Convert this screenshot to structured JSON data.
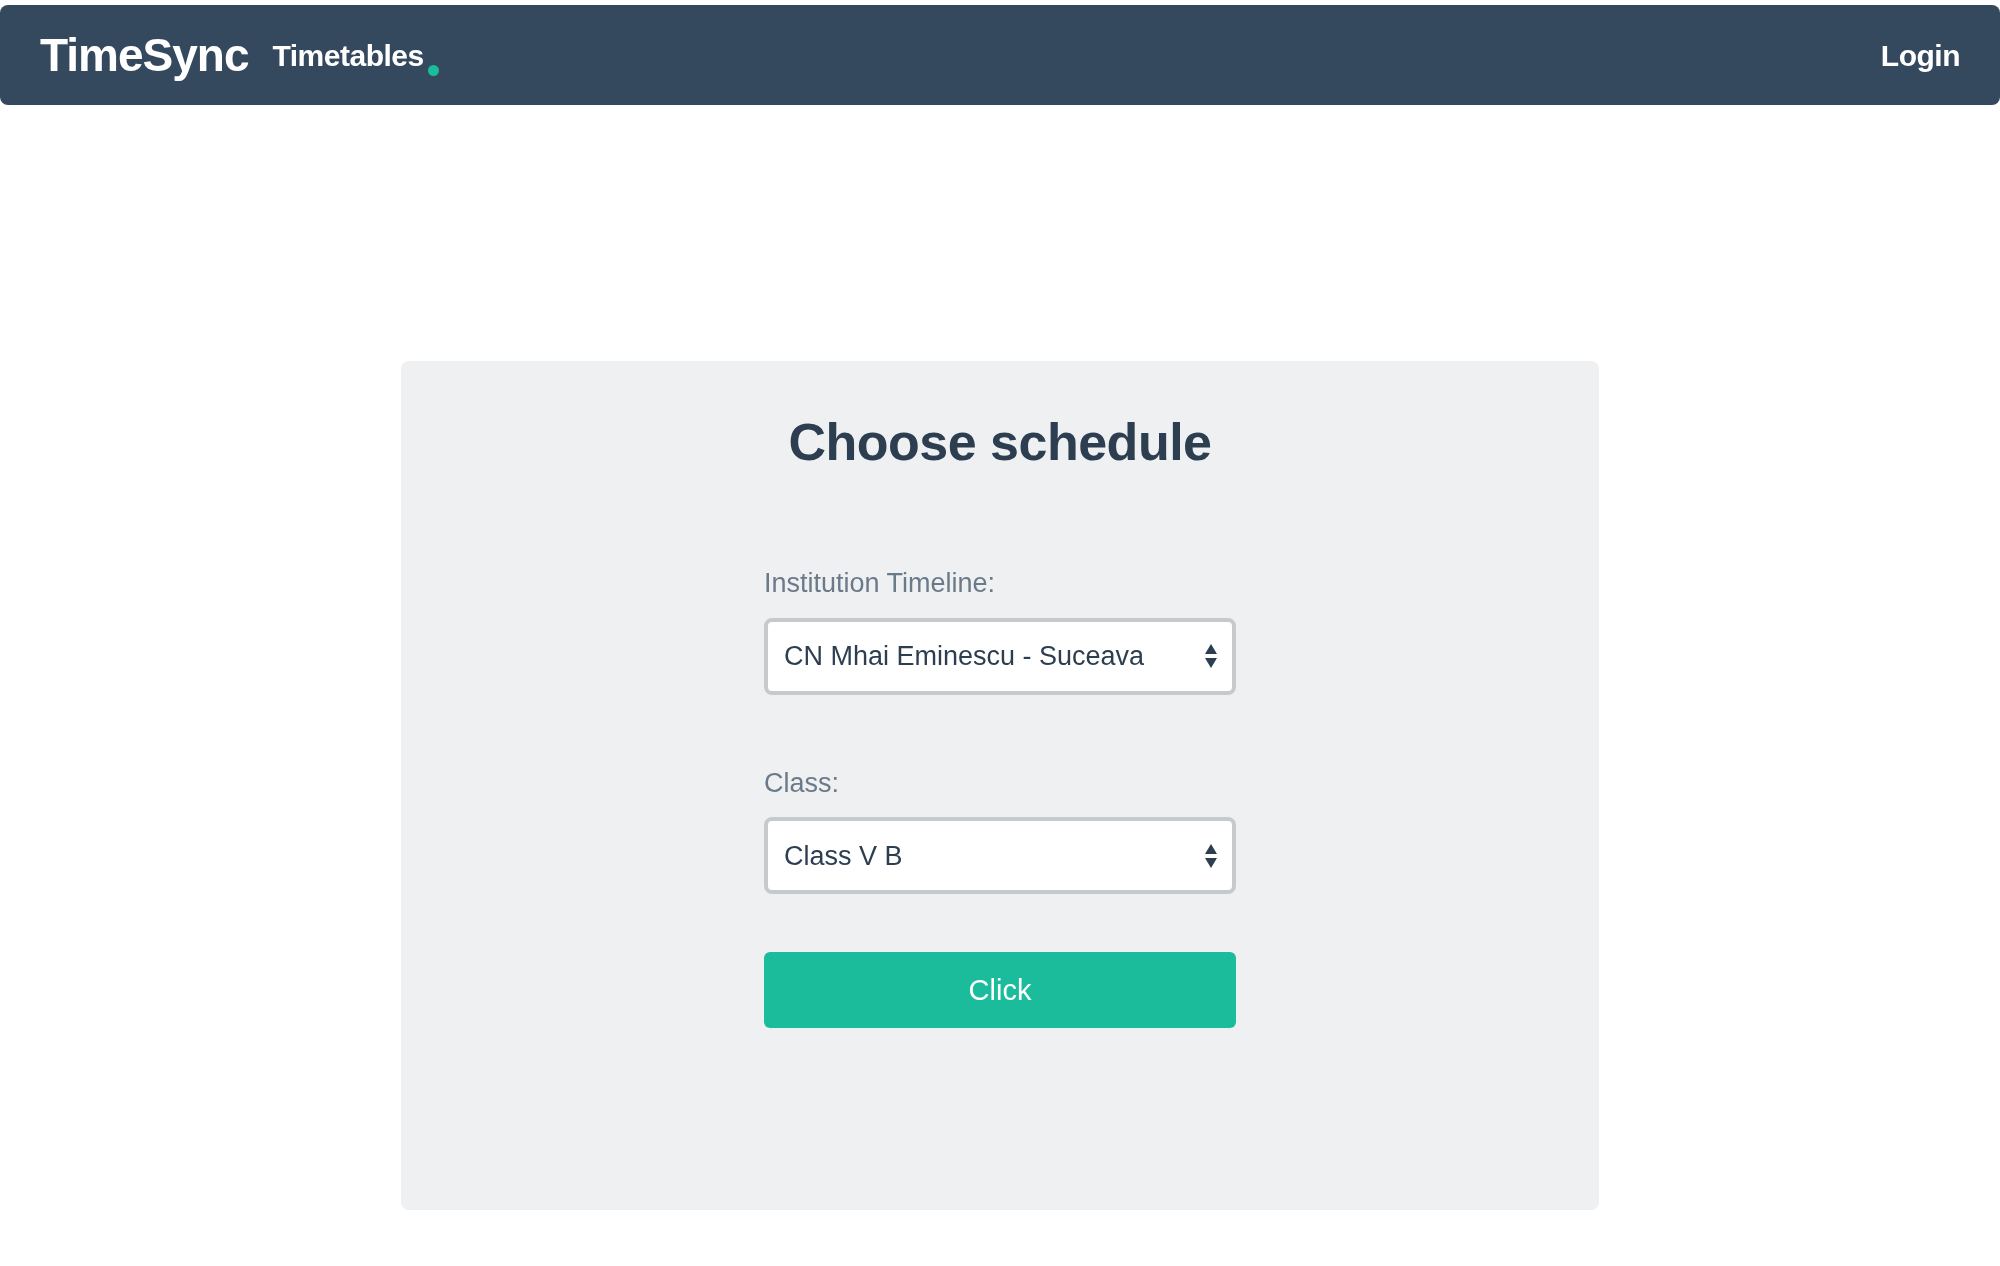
{
  "navbar": {
    "brand": "TimeSync",
    "links": [
      {
        "label": "Timetables",
        "has_indicator": true
      }
    ],
    "right_link": "Login"
  },
  "form": {
    "title": "Choose schedule",
    "fields": [
      {
        "label": "Institution Timeline:",
        "value": "CN Mhai Eminescu - Suceava"
      },
      {
        "label": "Class:",
        "value": "Class V B"
      }
    ],
    "button": "Click"
  }
}
